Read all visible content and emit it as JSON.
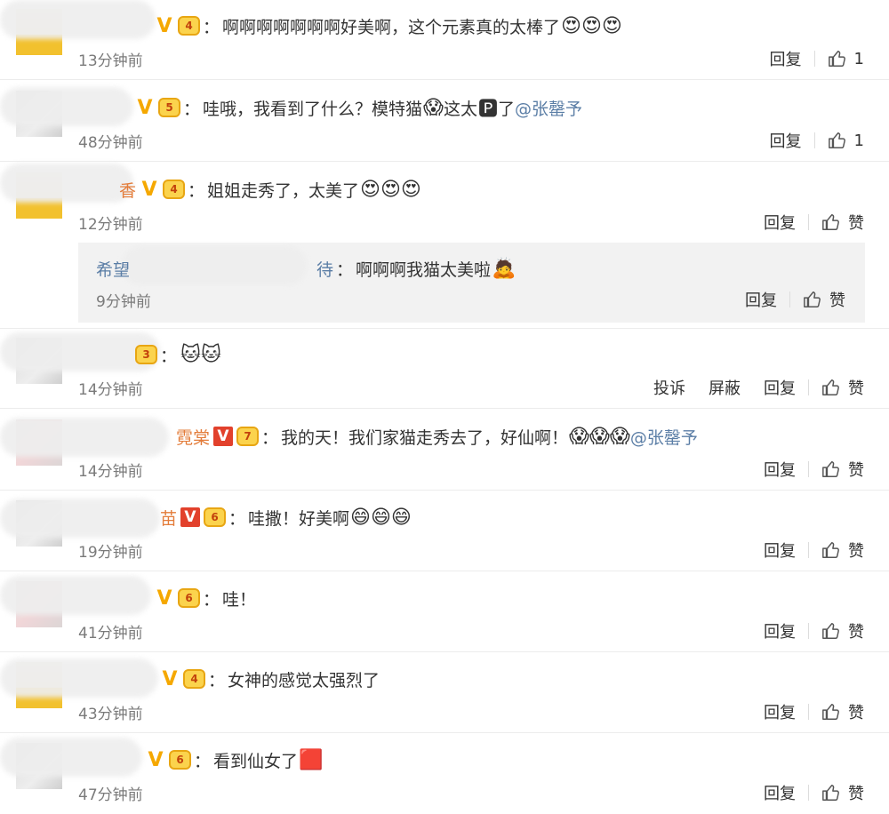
{
  "labels": {
    "reply": "回复",
    "praise": "赞",
    "report": "投诉",
    "block": "屏蔽"
  },
  "comments": [
    {
      "name": "",
      "text": "啊啊啊啊啊啊啊好美啊，这个元素真的太棒了",
      "emoji": "😍😍😍",
      "time": "13分钟前",
      "likes": "1",
      "level": "4"
    },
    {
      "name": "",
      "text": "哇哦，我看到了什么？模特猫",
      "emoji": "😱",
      "text2": " 这太",
      "emoji2": "🅿",
      "text3": " 了",
      "mention": "@张罄予",
      "time": "48分钟前",
      "likes": "1",
      "level": "5"
    },
    {
      "name": "香",
      "text": "姐姐走秀了，太美了",
      "emoji": "😍😍😍",
      "time": "12分钟前",
      "level": "4"
    },
    {
      "name": "",
      "text": "",
      "emoji": "🐱🐱",
      "time": "14分钟前",
      "level": "3"
    },
    {
      "name": "霓棠",
      "text": "我的天！我们家猫走秀去了，好仙啊！",
      "emoji": "😱😱😱",
      "mention": "@张罄予",
      "time": "14分钟前",
      "level": "7"
    },
    {
      "name": "苗",
      "text": "哇撒！好美啊",
      "emoji": "😄😄😄",
      "time": "19分钟前",
      "level": "6"
    },
    {
      "name": "",
      "text": "哇！",
      "time": "41分钟前",
      "level": "6"
    },
    {
      "name": "",
      "text": "女神的感觉太强烈了",
      "time": "43分钟前",
      "level": "4"
    },
    {
      "name": "",
      "text": "看到仙女了",
      "emoji": "🟥",
      "time": "47分钟前",
      "level": "6"
    }
  ],
  "reply": {
    "name_start": "希望",
    "name_end": "待",
    "text": "啊啊啊我猫太美啦",
    "emoji": "🙇",
    "time": "9分钟前"
  }
}
